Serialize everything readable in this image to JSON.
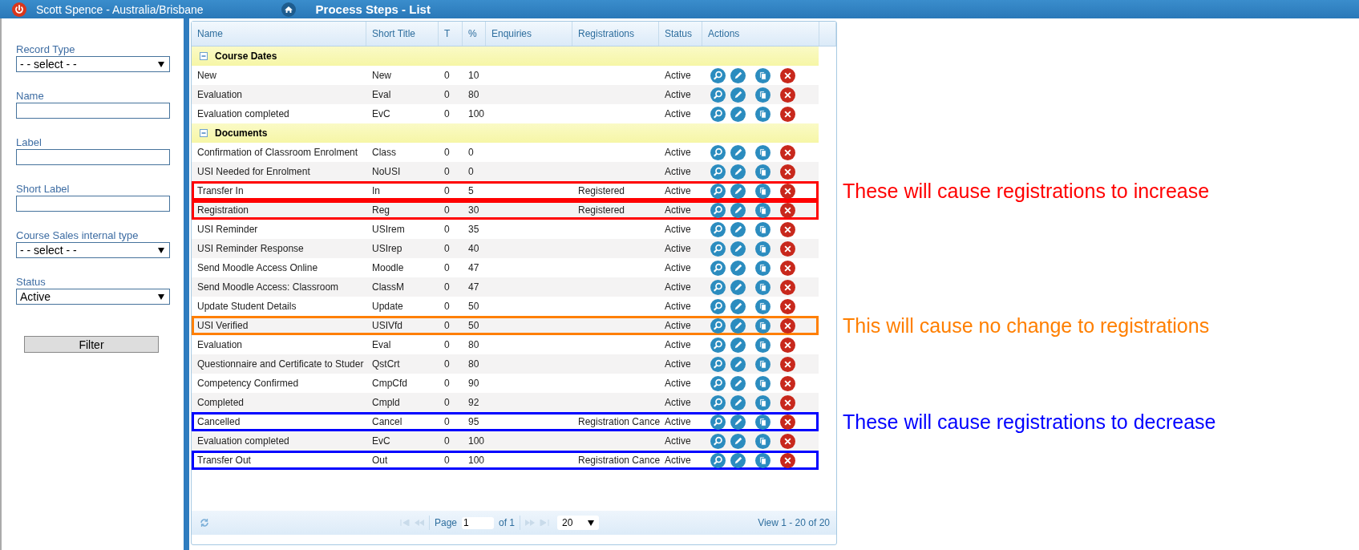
{
  "top_bar": {
    "user": "Scott Spence - Australia/Brisbane",
    "title": "Process Steps - List"
  },
  "filters": [
    {
      "kind": "select",
      "label": "Record Type",
      "value": "- - select - -"
    },
    {
      "kind": "text",
      "label": "Name"
    },
    {
      "kind": "text",
      "label": "Label"
    },
    {
      "kind": "text",
      "label": "Short Label"
    },
    {
      "kind": "select",
      "label": "Course Sales internal type",
      "value": "- - select - -"
    },
    {
      "kind": "select",
      "label": "Status",
      "value": "Active"
    }
  ],
  "filter_button": "Filter",
  "table": {
    "columns": [
      "Name",
      "Short Title",
      "T",
      "%",
      "Enquiries",
      "Registrations",
      "Status",
      "Actions"
    ],
    "groups": [
      {
        "title": "Course Dates",
        "expanded": true,
        "rows": [
          {
            "name": "New",
            "short_title": "New",
            "t": "0",
            "pct": "10",
            "status": "Active"
          },
          {
            "name": "Evaluation",
            "short_title": "Eval",
            "t": "0",
            "pct": "80",
            "status": "Active"
          },
          {
            "name": "Evaluation completed",
            "short_title": "EvC",
            "t": "0",
            "pct": "100",
            "status": "Active"
          }
        ]
      },
      {
        "title": "Documents",
        "expanded": true,
        "rows": [
          {
            "name": "Confirmation of Classroom Enrolment",
            "short_title": "Class",
            "t": "0",
            "pct": "0",
            "status": "Active"
          },
          {
            "name": "USI Needed for Enrolment",
            "short_title": "NoUSI",
            "t": "0",
            "pct": "0",
            "status": "Active"
          },
          {
            "name": "Transfer In",
            "short_title": "In",
            "t": "0",
            "pct": "5",
            "registrations": "Registered",
            "status": "Active",
            "color": "#ff0000",
            "annotation": "These will cause registrations to increase"
          },
          {
            "name": "Registration",
            "short_title": "Reg",
            "t": "0",
            "pct": "30",
            "registrations": "Registered",
            "status": "Active",
            "color": "#ff0000"
          },
          {
            "name": "USI Reminder",
            "short_title": "USIrem",
            "t": "0",
            "pct": "35",
            "status": "Active"
          },
          {
            "name": "USI Reminder Response",
            "short_title": "USIrep",
            "t": "0",
            "pct": "40",
            "status": "Active"
          },
          {
            "name": "Send Moodle Access Online",
            "short_title": "Moodle",
            "t": "0",
            "pct": "47",
            "status": "Active"
          },
          {
            "name": "Send Moodle Access: Classroom",
            "short_title": "ClassM",
            "t": "0",
            "pct": "47",
            "status": "Active"
          },
          {
            "name": "Update Student Details",
            "short_title": "Update",
            "t": "0",
            "pct": "50",
            "status": "Active"
          },
          {
            "name": "USI Verified",
            "short_title": "USIVfd",
            "t": "0",
            "pct": "50",
            "status": "Active",
            "color": "#ff7f00",
            "annotation": "This will cause no change to registrations"
          },
          {
            "name": "Evaluation",
            "short_title": "Eval",
            "t": "0",
            "pct": "80",
            "status": "Active"
          },
          {
            "name": "Questionnaire and Certificate to Studer",
            "short_title": "QstCrt",
            "t": "0",
            "pct": "80",
            "status": "Active"
          },
          {
            "name": "Competency Confirmed",
            "short_title": "CmpCfd",
            "t": "0",
            "pct": "90",
            "status": "Active"
          },
          {
            "name": "Completed",
            "short_title": "Cmpld",
            "t": "0",
            "pct": "92",
            "status": "Active"
          },
          {
            "name": "Cancelled",
            "short_title": "Cancel",
            "t": "0",
            "pct": "95",
            "registrations": "Registration Cance",
            "status": "Active",
            "color": "#0000ff",
            "annotation": "These will cause registrations to decrease"
          },
          {
            "name": "Evaluation completed",
            "short_title": "EvC",
            "t": "0",
            "pct": "100",
            "status": "Active"
          },
          {
            "name": "Transfer Out",
            "short_title": "Out",
            "t": "0",
            "pct": "100",
            "registrations": "Registration Cance",
            "status": "Active",
            "color": "#0000ff"
          }
        ]
      }
    ]
  },
  "pager": {
    "page_label": "Page",
    "page": "1",
    "of": "of 1",
    "page_size": "20",
    "view": "View 1 - 20 of 20"
  }
}
